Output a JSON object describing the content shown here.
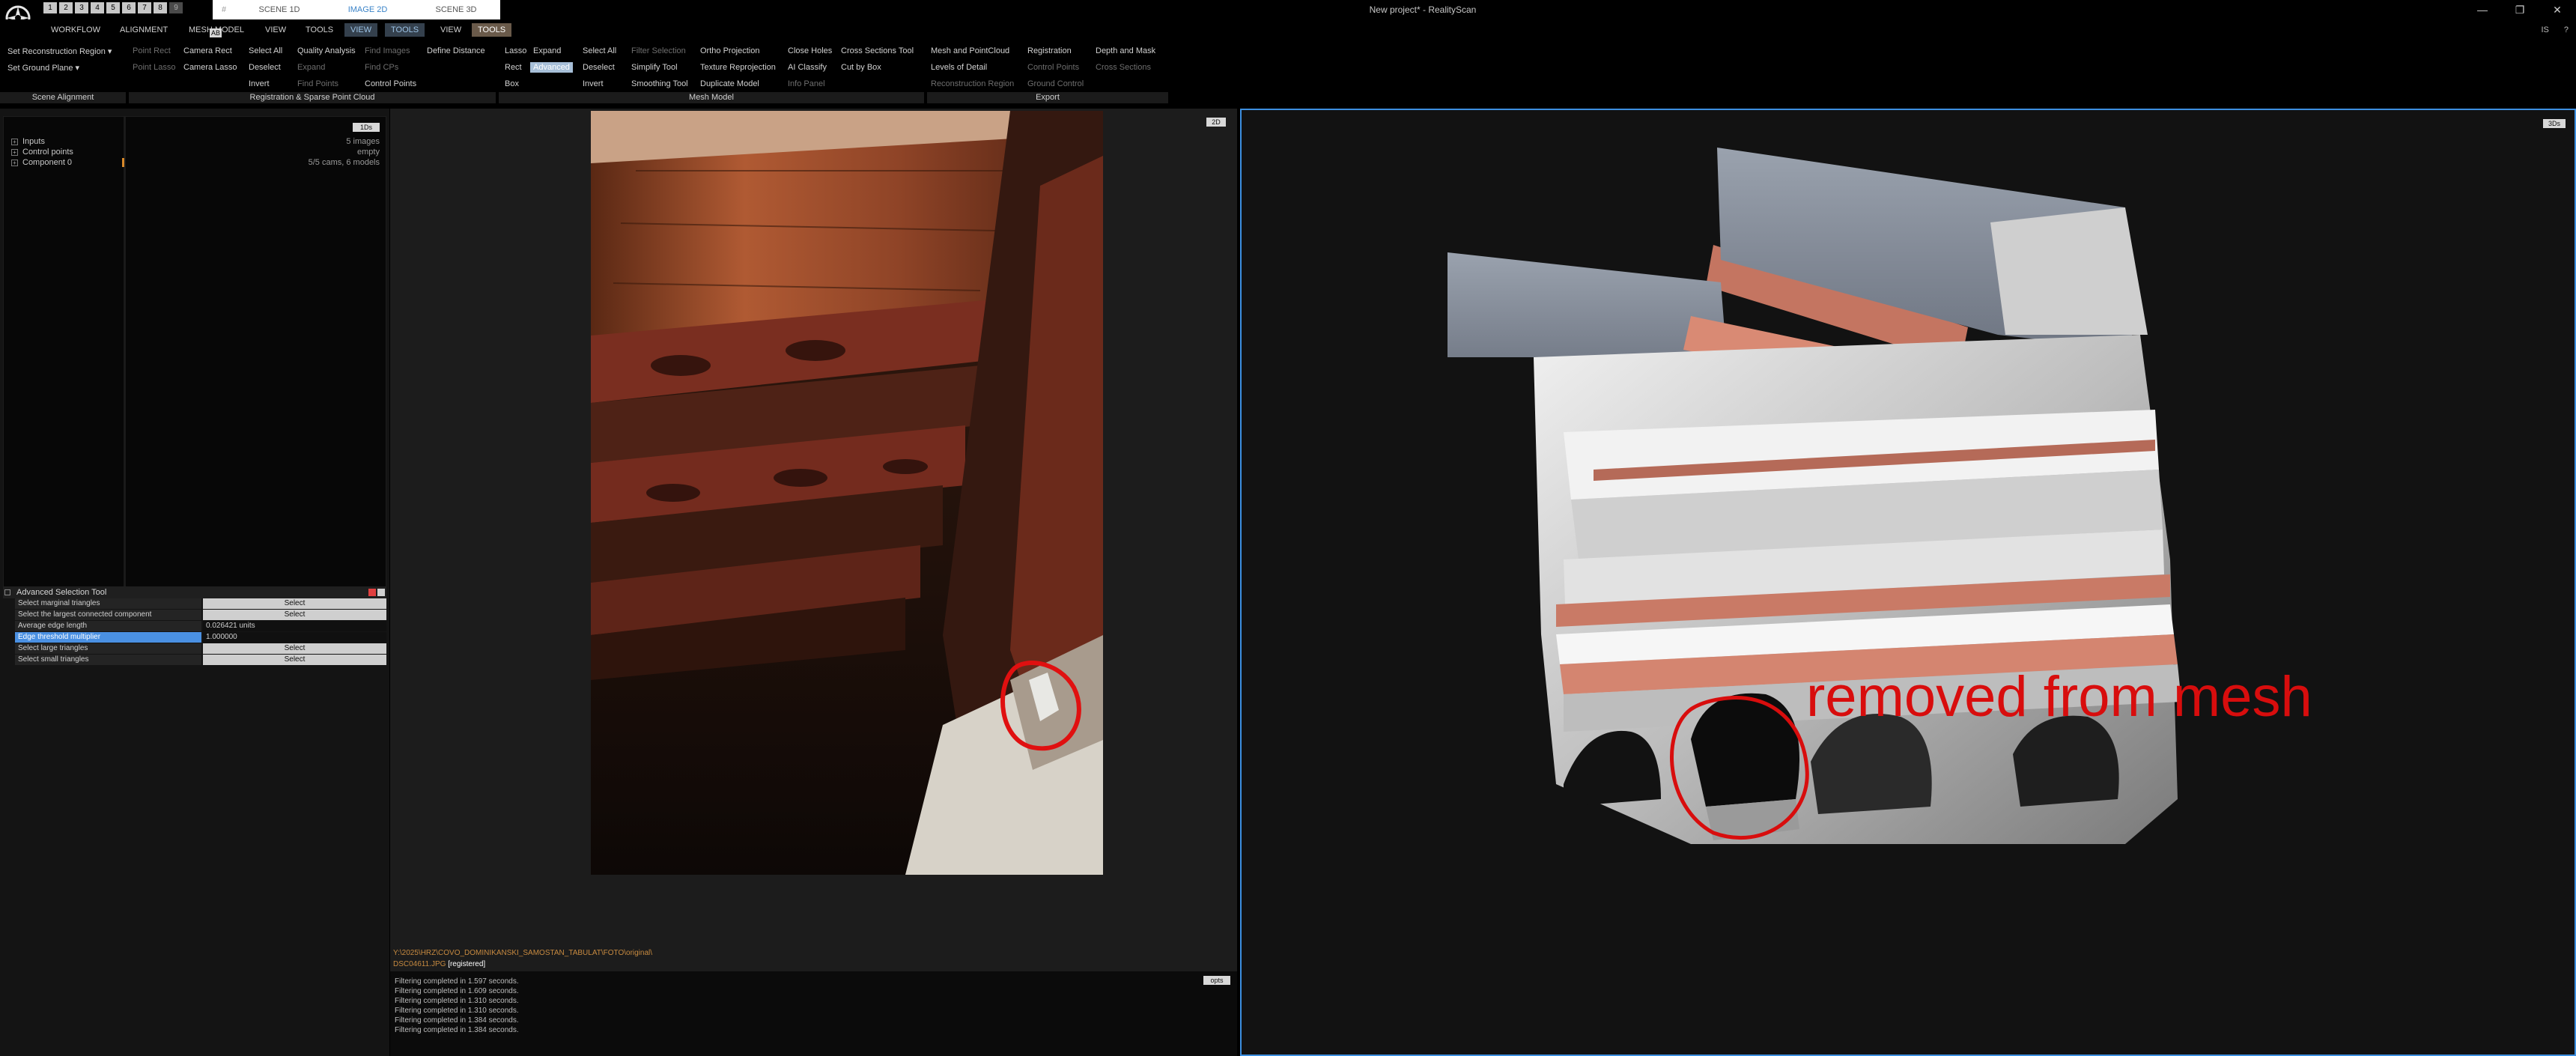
{
  "window": {
    "title": "New project* - RealityScan",
    "quick_buttons": [
      "1",
      "2",
      "3",
      "4",
      "5",
      "6",
      "7",
      "8",
      "9"
    ],
    "scene_tabs": [
      "SCENE 1D",
      "IMAGE 2D",
      "SCENE 3D"
    ],
    "hash_tab": "#",
    "controls": [
      "—",
      "❐",
      "✕"
    ]
  },
  "menu": {
    "items": [
      "WORKFLOW",
      "ALIGNMENT",
      "MESH MODEL",
      "VIEW",
      "TOOLS",
      "VIEW",
      "TOOLS",
      "VIEW",
      "TOOLS"
    ],
    "badge": "AB",
    "right_icons": [
      "IS",
      "?"
    ]
  },
  "ribbon": {
    "scene_alignment": {
      "set_reconstruction_region": "Set Reconstruction Region",
      "set_ground_plane": "Set Ground Plane",
      "label": "Scene Alignment"
    },
    "registration": {
      "point_rect": "Point Rect",
      "camera_rect": "Camera Rect",
      "select_all": "Select All",
      "quality_analysis": "Quality Analysis",
      "find_images": "Find Images",
      "define_distance": "Define Distance",
      "point_lasso": "Point Lasso",
      "camera_lasso": "Camera Lasso",
      "deselect": "Deselect",
      "expand": "Expand",
      "find_cps": "Find CPs",
      "invert": "Invert",
      "find_points": "Find Points",
      "control_points": "Control Points",
      "label": "Registration & Sparse Point Cloud"
    },
    "mesh_model": {
      "lasso": "Lasso",
      "expand": "Expand",
      "select_all": "Select All",
      "filter_selection": "Filter Selection",
      "ortho_projection": "Ortho Projection",
      "close_holes": "Close Holes",
      "cross_sections_tool": "Cross Sections Tool",
      "rect": "Rect",
      "advanced": "Advanced",
      "deselect": "Deselect",
      "simplify_tool": "Simplify Tool",
      "texture_reprojection": "Texture Reprojection",
      "ai_classify": "AI Classify",
      "cut_by_box": "Cut by Box",
      "box": "Box",
      "invert": "Invert",
      "smoothing_tool": "Smoothing Tool",
      "duplicate_model": "Duplicate Model",
      "info_panel": "Info Panel",
      "label": "Mesh Model"
    },
    "export": {
      "mesh_and_pointcloud": "Mesh and PointCloud",
      "registration": "Registration",
      "depth_and_mask": "Depth and Mask",
      "levels_of_detail": "Levels of Detail",
      "control_points": "Control Points",
      "cross_sections": "Cross Sections",
      "reconstruction_region": "Reconstruction Region",
      "ground_control": "Ground Control",
      "label": "Export"
    }
  },
  "tree": {
    "btn": "1Ds",
    "items": [
      {
        "label": "Inputs",
        "value": "5 images"
      },
      {
        "label": "Control points",
        "value": "empty"
      },
      {
        "label": "Component 0",
        "value": "5/5 cams, 6 models"
      }
    ]
  },
  "advanced_selection_tool": {
    "title": "Advanced Selection Tool",
    "rows": [
      {
        "label": "Select marginal triangles",
        "value": "Select",
        "kind": "btn"
      },
      {
        "label": "Select the largest connected component",
        "value": "Select",
        "kind": "btn"
      },
      {
        "label": "Average edge length",
        "value": "0.026421 units",
        "kind": "txt"
      },
      {
        "label": "Edge threshold multiplier",
        "value": "1.000000",
        "kind": "txt",
        "highlight": true
      },
      {
        "label": "Select large triangles",
        "value": "Select",
        "kind": "btn"
      },
      {
        "label": "Select small triangles",
        "value": "Select",
        "kind": "btn"
      }
    ]
  },
  "view2d": {
    "btn": "2D",
    "path": "Y:\\2025\\HRZ\\COVO_DOMINIKANSKI_SAMOSTAN_TABULAT\\FOTO\\original\\",
    "file": "DSC04611.JPG",
    "status": "[registered]",
    "console_btn": "opts",
    "log": [
      "Filtering completed in 1.597 seconds.",
      "Filtering completed in 1.609 seconds.",
      "Filtering completed in 1.310 seconds.",
      "Filtering completed in 1.310 seconds.",
      "Filtering completed in 1.384 seconds.",
      "Filtering completed in 1.384 seconds."
    ]
  },
  "view3d": {
    "btn": "3Ds",
    "annotation": "removed from mesh"
  },
  "colors": {
    "accent": "#3d8fe0",
    "annotation_red": "#d80d0d",
    "highlight_blue": "#4a90e2",
    "path_orange": "#c78a40"
  }
}
